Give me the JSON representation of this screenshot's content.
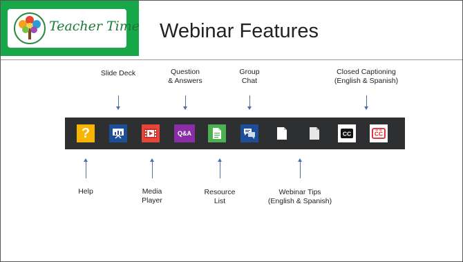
{
  "header": {
    "logo_text": "Teacher Time",
    "title": "Webinar Features"
  },
  "colors": {
    "logo_green": "#18a84a",
    "toolbar_bg": "#2e2f31",
    "arrow": "#4a6fa5"
  },
  "labels_top": [
    {
      "text": "Slide Deck"
    },
    {
      "text": "Question\n& Answers"
    },
    {
      "text": "Group\nChat"
    },
    {
      "text": "Closed Captioning\n(English & Spanish)"
    }
  ],
  "labels_bottom": [
    {
      "text": "Help"
    },
    {
      "text": "Media\nPlayer"
    },
    {
      "text": "Resource\nList"
    },
    {
      "text": "Webinar Tips\n(English & Spanish)"
    }
  ],
  "toolbar": {
    "tools": [
      {
        "name": "Help",
        "icon": "question-icon",
        "glyph": "?"
      },
      {
        "name": "Slide Deck",
        "icon": "presentation-icon"
      },
      {
        "name": "Media Player",
        "icon": "film-icon"
      },
      {
        "name": "Question & Answers",
        "icon": "qa-icon",
        "glyph": "Q&A"
      },
      {
        "name": "Resource List",
        "icon": "document-icon"
      },
      {
        "name": "Group Chat",
        "icon": "chat-icon"
      },
      {
        "name": "Webinar Tips English",
        "icon": "document-icon"
      },
      {
        "name": "Webinar Tips Spanish",
        "icon": "document-icon"
      },
      {
        "name": "Closed Captioning English",
        "icon": "cc-icon",
        "glyph": "CC"
      },
      {
        "name": "Closed Captioning Spanish",
        "icon": "cc-icon",
        "glyph": "CC"
      }
    ]
  }
}
